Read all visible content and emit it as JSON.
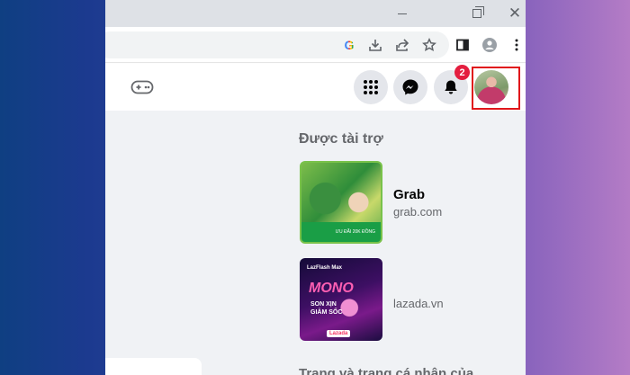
{
  "window": {
    "controls": {
      "minimize": "—",
      "maximize": "❐",
      "close": "✕"
    }
  },
  "toolbar": {
    "icons": [
      "google-icon",
      "download-icon",
      "share-icon",
      "star-icon",
      "sidebar-icon",
      "profile-icon",
      "kebab-menu-icon"
    ],
    "google_letter": "G"
  },
  "header": {
    "icons": [
      "gaming-icon",
      "menu-grid-icon",
      "messenger-icon",
      "bell-icon",
      "avatar"
    ],
    "notification_count": "2"
  },
  "sponsored": {
    "title": "Được tài trợ",
    "ads": [
      {
        "name": "Grab",
        "domain": "grab.com",
        "image_tag": "ƯU ĐÃI 20K ĐỒNG"
      },
      {
        "name": "",
        "domain": "lazada.vn",
        "image_text": {
          "top": "LazFlash Max",
          "headline": "MONO",
          "line1": "SON XỊN",
          "line2": "GIẢM SỐC",
          "logo": "Lazada"
        }
      }
    ],
    "next_section_partial": "Trang và trang cá nhân của"
  },
  "colors": {
    "accent_red": "#e0161b",
    "badge_red": "#e41e3f",
    "button_gray": "#e4e6eb",
    "feed_bg": "#f0f2f5"
  }
}
